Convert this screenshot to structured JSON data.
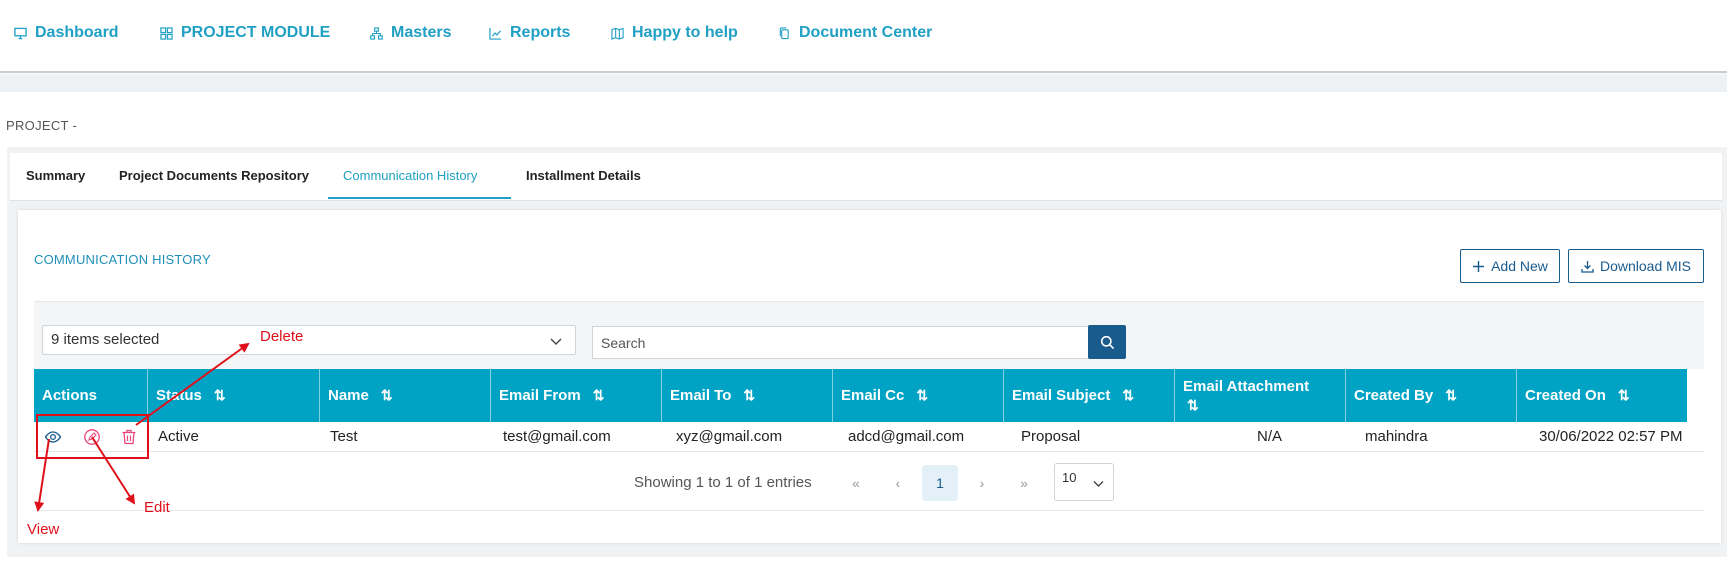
{
  "nav": {
    "items": [
      {
        "label": "Dashboard",
        "icon": "monitor-icon"
      },
      {
        "label": "PROJECT MODULE",
        "icon": "grid-icon"
      },
      {
        "label": "Masters",
        "icon": "sitemap-icon"
      },
      {
        "label": "Reports",
        "icon": "line-chart-icon"
      },
      {
        "label": "Happy to help",
        "icon": "map-icon"
      },
      {
        "label": "Document Center",
        "icon": "copy-icon"
      }
    ]
  },
  "breadcrumb": "PROJECT -",
  "tabs": [
    {
      "label": "Summary",
      "active": false
    },
    {
      "label": "Project Documents Repository",
      "active": false
    },
    {
      "label": "Communication History",
      "active": true
    },
    {
      "label": "Installment Details",
      "active": false
    }
  ],
  "section": {
    "title": "COMMUNICATION HISTORY",
    "add_new": "Add New",
    "download_mis": "Download MIS"
  },
  "filters": {
    "column_select": "9 items selected",
    "search_placeholder": "Search"
  },
  "table": {
    "columns": [
      "Actions",
      "Status",
      "Name",
      "Email From",
      "Email To",
      "Email Cc",
      "Email Subject",
      "Email Attachment",
      "Created By",
      "Created On"
    ],
    "sort_glyph": "⇅",
    "rows": [
      [
        "",
        "Active",
        "Test",
        "test@gmail.com",
        "xyz@gmail.com",
        "adcd@gmail.com",
        "Proposal",
        "N/A",
        "mahindra",
        "30/06/2022 02:57 PM"
      ]
    ]
  },
  "pagination": {
    "summary": "Showing 1 to 1 of 1 entries",
    "first": "«",
    "prev": "‹",
    "current": "1",
    "next": "›",
    "last": "»",
    "page_size": "10"
  },
  "annotations": {
    "delete": "Delete",
    "edit": "Edit",
    "view": "View"
  },
  "colors": {
    "accent": "#1fa0c4",
    "header": "#00a3c4",
    "primary": "#1a5b8e",
    "annotation": "#e0101a",
    "delete_icon": "#e8457a"
  }
}
